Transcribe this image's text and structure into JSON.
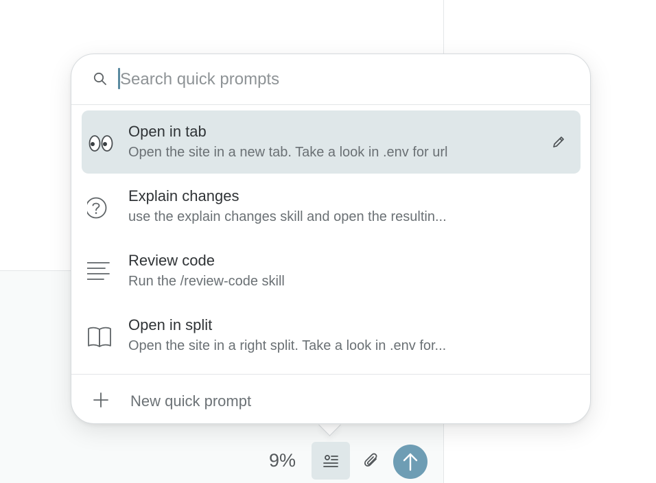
{
  "search": {
    "placeholder": "Search quick prompts"
  },
  "prompts": [
    {
      "title": "Open in tab",
      "description": "Open the site in a new tab. Take a look in .env for url",
      "icon": "eyes-icon",
      "selected": true
    },
    {
      "title": "Explain changes",
      "description": "use the explain changes skill and open the resultin...",
      "icon": "question-circle-icon",
      "selected": false
    },
    {
      "title": "Review code",
      "description": "Run the /review-code skill",
      "icon": "align-left-icon",
      "selected": false
    },
    {
      "title": "Open in split",
      "description": "Open the site in a right split. Take a look in .env for...",
      "icon": "book-icon",
      "selected": false
    }
  ],
  "footer": {
    "new_label": "New quick prompt"
  },
  "toolbar": {
    "percent": "9%"
  },
  "colors": {
    "selected_bg": "#dfe7e9",
    "accent": "#6e9db4",
    "caret": "#5a8aa0"
  }
}
